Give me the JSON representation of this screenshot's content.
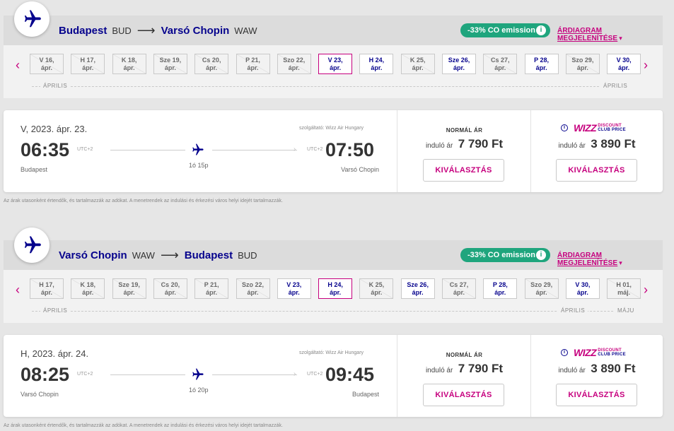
{
  "colors": {
    "brand": "#06038d",
    "accent": "#c6007e",
    "emission": "#1fa57d",
    "background": "#e6e6e6"
  },
  "outbound": {
    "origin_city": "Budapest",
    "origin_code": "BUD",
    "destination_city": "Varsó Chopin",
    "destination_code": "WAW",
    "arrow": "⟶",
    "emission": "-33% CO emission",
    "info_glyph": "i",
    "chart_link": "ÁRDIAGRAM MEGJELENÍTÉSE",
    "chart_link_caret": "▾",
    "prev": "‹",
    "next": "›",
    "dates": [
      {
        "l1": "V 16,",
        "l2": "ápr.",
        "state": "disabled"
      },
      {
        "l1": "H 17,",
        "l2": "ápr.",
        "state": "disabled"
      },
      {
        "l1": "K 18,",
        "l2": "ápr.",
        "state": "disabled"
      },
      {
        "l1": "Sze 19,",
        "l2": "ápr.",
        "state": "disabled"
      },
      {
        "l1": "Cs 20,",
        "l2": "ápr.",
        "state": "disabled"
      },
      {
        "l1": "P 21,",
        "l2": "ápr.",
        "state": "disabled"
      },
      {
        "l1": "Szo 22,",
        "l2": "ápr.",
        "state": "disabled"
      },
      {
        "l1": "V 23,",
        "l2": "ápr.",
        "state": "selected"
      },
      {
        "l1": "H 24,",
        "l2": "ápr.",
        "state": "available"
      },
      {
        "l1": "K 25,",
        "l2": "ápr.",
        "state": "disabled"
      },
      {
        "l1": "Sze 26,",
        "l2": "ápr.",
        "state": "available"
      },
      {
        "l1": "Cs 27,",
        "l2": "ápr.",
        "state": "disabled"
      },
      {
        "l1": "P 28,",
        "l2": "ápr.",
        "state": "available"
      },
      {
        "l1": "Szo 29,",
        "l2": "ápr.",
        "state": "disabled"
      },
      {
        "l1": "V 30,",
        "l2": "ápr.",
        "state": "available"
      }
    ],
    "month_left": "ÁPRILIS",
    "month_right": "ÁPRILIS",
    "flight": {
      "date": "V, 2023. ápr. 23.",
      "operator": "szolgáltató: Wizz Air Hungary",
      "dep_time": "06:35",
      "dep_utc": "UTC+2",
      "dep_city": "Budapest",
      "arr_time": "07:50",
      "arr_utc": "UTC+2",
      "arr_city": "Varsó Chopin",
      "duration": "1ó 15p",
      "track_end": "›"
    },
    "normal": {
      "header": "NORMÁL ÁR",
      "from": "induló ár",
      "price": "7 790 Ft",
      "button": "KIVÁLASZTÁS"
    },
    "club": {
      "info": "i",
      "brand": "WIZZ",
      "line1": "DISCOUNT",
      "line2": "CLUB PRICE",
      "from": "induló ár",
      "price": "3 890 Ft",
      "button": "KIVÁLASZTÁS"
    },
    "disclaimer": "Az árak utasonként értendők, és tartalmazzák az adókat. A menetrendek az indulási és érkezési város helyi idejét tartalmazzák."
  },
  "return": {
    "origin_city": "Varsó Chopin",
    "origin_code": "WAW",
    "destination_city": "Budapest",
    "destination_code": "BUD",
    "arrow": "⟶",
    "emission": "-33% CO emission",
    "info_glyph": "i",
    "chart_link": "ÁRDIAGRAM MEGJELENÍTÉSE",
    "chart_link_caret": "▾",
    "prev": "‹",
    "next": "›",
    "dates": [
      {
        "l1": "H 17,",
        "l2": "ápr.",
        "state": "disabled"
      },
      {
        "l1": "K 18,",
        "l2": "ápr.",
        "state": "disabled"
      },
      {
        "l1": "Sze 19,",
        "l2": "ápr.",
        "state": "disabled"
      },
      {
        "l1": "Cs 20,",
        "l2": "ápr.",
        "state": "disabled"
      },
      {
        "l1": "P 21,",
        "l2": "ápr.",
        "state": "disabled"
      },
      {
        "l1": "Szo 22,",
        "l2": "ápr.",
        "state": "disabled"
      },
      {
        "l1": "V 23,",
        "l2": "ápr.",
        "state": "available"
      },
      {
        "l1": "H 24,",
        "l2": "ápr.",
        "state": "selected"
      },
      {
        "l1": "K 25,",
        "l2": "ápr.",
        "state": "disabled"
      },
      {
        "l1": "Sze 26,",
        "l2": "ápr.",
        "state": "available"
      },
      {
        "l1": "Cs 27,",
        "l2": "ápr.",
        "state": "disabled"
      },
      {
        "l1": "P 28,",
        "l2": "ápr.",
        "state": "available"
      },
      {
        "l1": "Szo 29,",
        "l2": "ápr.",
        "state": "disabled"
      },
      {
        "l1": "V 30,",
        "l2": "ápr.",
        "state": "available"
      },
      {
        "l1": "H 01,",
        "l2": "máj.",
        "state": "disabled"
      }
    ],
    "month_left": "ÁPRILIS",
    "month_right": "ÁPRILIS",
    "month_next": "MÁJU",
    "flight": {
      "date": "H, 2023. ápr. 24.",
      "operator": "szolgáltató: Wizz Air Hungary",
      "dep_time": "08:25",
      "dep_utc": "UTC+2",
      "dep_city": "Varsó Chopin",
      "arr_time": "09:45",
      "arr_utc": "UTC+2",
      "arr_city": "Budapest",
      "duration": "1ó 20p",
      "track_end": "›"
    },
    "normal": {
      "header": "NORMÁL ÁR",
      "from": "induló ár",
      "price": "7 790 Ft",
      "button": "KIVÁLASZTÁS"
    },
    "club": {
      "info": "i",
      "brand": "WIZZ",
      "line1": "DISCOUNT",
      "line2": "CLUB PRICE",
      "from": "induló ár",
      "price": "3 890 Ft",
      "button": "KIVÁLASZTÁS"
    },
    "disclaimer": "Az árak utasonként értendők, és tartalmazzák az adókat. A menetrendek az indulási és érkezési város helyi idejét tartalmazzák."
  }
}
